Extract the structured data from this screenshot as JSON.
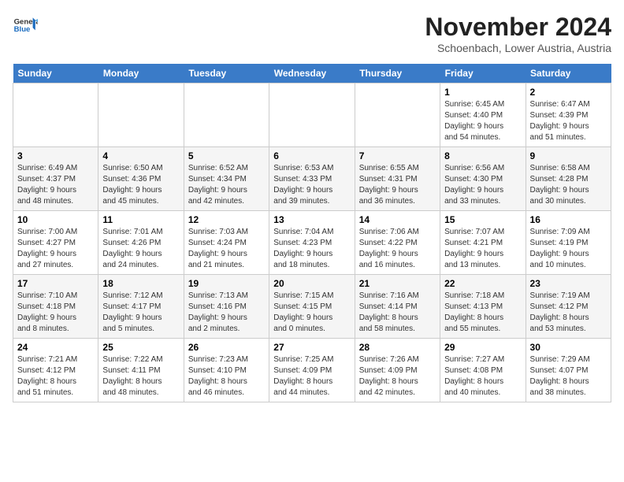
{
  "logo": {
    "general": "General",
    "blue": "Blue"
  },
  "title": "November 2024",
  "location": "Schoenbach, Lower Austria, Austria",
  "days_of_week": [
    "Sunday",
    "Monday",
    "Tuesday",
    "Wednesday",
    "Thursday",
    "Friday",
    "Saturday"
  ],
  "weeks": [
    [
      {
        "day": "",
        "info": ""
      },
      {
        "day": "",
        "info": ""
      },
      {
        "day": "",
        "info": ""
      },
      {
        "day": "",
        "info": ""
      },
      {
        "day": "",
        "info": ""
      },
      {
        "day": "1",
        "info": "Sunrise: 6:45 AM\nSunset: 4:40 PM\nDaylight: 9 hours\nand 54 minutes."
      },
      {
        "day": "2",
        "info": "Sunrise: 6:47 AM\nSunset: 4:39 PM\nDaylight: 9 hours\nand 51 minutes."
      }
    ],
    [
      {
        "day": "3",
        "info": "Sunrise: 6:49 AM\nSunset: 4:37 PM\nDaylight: 9 hours\nand 48 minutes."
      },
      {
        "day": "4",
        "info": "Sunrise: 6:50 AM\nSunset: 4:36 PM\nDaylight: 9 hours\nand 45 minutes."
      },
      {
        "day": "5",
        "info": "Sunrise: 6:52 AM\nSunset: 4:34 PM\nDaylight: 9 hours\nand 42 minutes."
      },
      {
        "day": "6",
        "info": "Sunrise: 6:53 AM\nSunset: 4:33 PM\nDaylight: 9 hours\nand 39 minutes."
      },
      {
        "day": "7",
        "info": "Sunrise: 6:55 AM\nSunset: 4:31 PM\nDaylight: 9 hours\nand 36 minutes."
      },
      {
        "day": "8",
        "info": "Sunrise: 6:56 AM\nSunset: 4:30 PM\nDaylight: 9 hours\nand 33 minutes."
      },
      {
        "day": "9",
        "info": "Sunrise: 6:58 AM\nSunset: 4:28 PM\nDaylight: 9 hours\nand 30 minutes."
      }
    ],
    [
      {
        "day": "10",
        "info": "Sunrise: 7:00 AM\nSunset: 4:27 PM\nDaylight: 9 hours\nand 27 minutes."
      },
      {
        "day": "11",
        "info": "Sunrise: 7:01 AM\nSunset: 4:26 PM\nDaylight: 9 hours\nand 24 minutes."
      },
      {
        "day": "12",
        "info": "Sunrise: 7:03 AM\nSunset: 4:24 PM\nDaylight: 9 hours\nand 21 minutes."
      },
      {
        "day": "13",
        "info": "Sunrise: 7:04 AM\nSunset: 4:23 PM\nDaylight: 9 hours\nand 18 minutes."
      },
      {
        "day": "14",
        "info": "Sunrise: 7:06 AM\nSunset: 4:22 PM\nDaylight: 9 hours\nand 16 minutes."
      },
      {
        "day": "15",
        "info": "Sunrise: 7:07 AM\nSunset: 4:21 PM\nDaylight: 9 hours\nand 13 minutes."
      },
      {
        "day": "16",
        "info": "Sunrise: 7:09 AM\nSunset: 4:19 PM\nDaylight: 9 hours\nand 10 minutes."
      }
    ],
    [
      {
        "day": "17",
        "info": "Sunrise: 7:10 AM\nSunset: 4:18 PM\nDaylight: 9 hours\nand 8 minutes."
      },
      {
        "day": "18",
        "info": "Sunrise: 7:12 AM\nSunset: 4:17 PM\nDaylight: 9 hours\nand 5 minutes."
      },
      {
        "day": "19",
        "info": "Sunrise: 7:13 AM\nSunset: 4:16 PM\nDaylight: 9 hours\nand 2 minutes."
      },
      {
        "day": "20",
        "info": "Sunrise: 7:15 AM\nSunset: 4:15 PM\nDaylight: 9 hours\nand 0 minutes."
      },
      {
        "day": "21",
        "info": "Sunrise: 7:16 AM\nSunset: 4:14 PM\nDaylight: 8 hours\nand 58 minutes."
      },
      {
        "day": "22",
        "info": "Sunrise: 7:18 AM\nSunset: 4:13 PM\nDaylight: 8 hours\nand 55 minutes."
      },
      {
        "day": "23",
        "info": "Sunrise: 7:19 AM\nSunset: 4:12 PM\nDaylight: 8 hours\nand 53 minutes."
      }
    ],
    [
      {
        "day": "24",
        "info": "Sunrise: 7:21 AM\nSunset: 4:12 PM\nDaylight: 8 hours\nand 51 minutes."
      },
      {
        "day": "25",
        "info": "Sunrise: 7:22 AM\nSunset: 4:11 PM\nDaylight: 8 hours\nand 48 minutes."
      },
      {
        "day": "26",
        "info": "Sunrise: 7:23 AM\nSunset: 4:10 PM\nDaylight: 8 hours\nand 46 minutes."
      },
      {
        "day": "27",
        "info": "Sunrise: 7:25 AM\nSunset: 4:09 PM\nDaylight: 8 hours\nand 44 minutes."
      },
      {
        "day": "28",
        "info": "Sunrise: 7:26 AM\nSunset: 4:09 PM\nDaylight: 8 hours\nand 42 minutes."
      },
      {
        "day": "29",
        "info": "Sunrise: 7:27 AM\nSunset: 4:08 PM\nDaylight: 8 hours\nand 40 minutes."
      },
      {
        "day": "30",
        "info": "Sunrise: 7:29 AM\nSunset: 4:07 PM\nDaylight: 8 hours\nand 38 minutes."
      }
    ]
  ]
}
